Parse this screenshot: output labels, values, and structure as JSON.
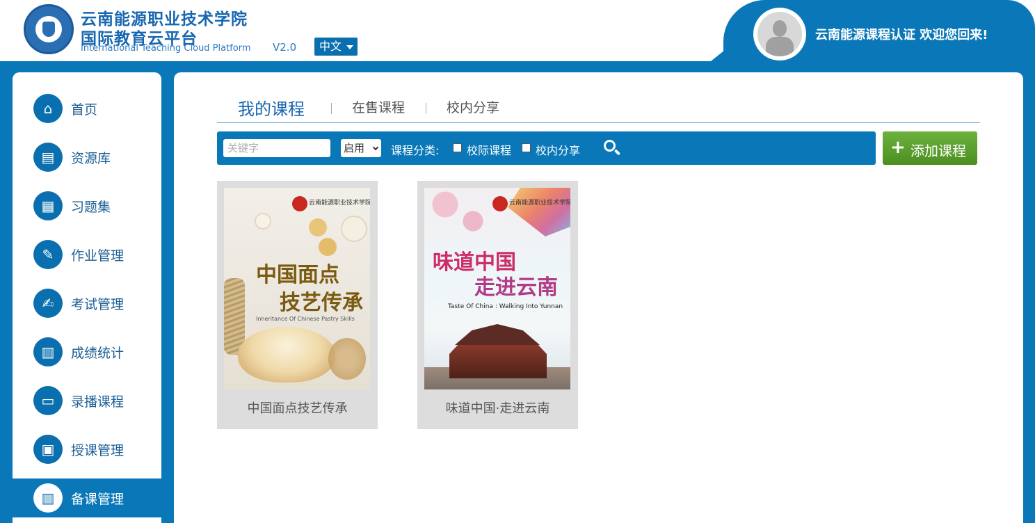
{
  "header": {
    "school_name": "云南能源职业技术学院",
    "platform_name": "国际教育云平台",
    "platform_name_en": "International Teaching Cloud Platform",
    "version": "V2.0",
    "language": "中文",
    "welcome": "云南能源课程认证 欢迎您回来!"
  },
  "sidebar": {
    "items": [
      {
        "label": "首页",
        "icon": "home-icon",
        "glyph": "⌂"
      },
      {
        "label": "资源库",
        "icon": "briefcase-icon",
        "glyph": "▤"
      },
      {
        "label": "习题集",
        "icon": "notebook-icon",
        "glyph": "▦"
      },
      {
        "label": "作业管理",
        "icon": "edit-icon",
        "glyph": "✎"
      },
      {
        "label": "考试管理",
        "icon": "exam-icon",
        "glyph": "✍"
      },
      {
        "label": "成绩统计",
        "icon": "bar-chart-icon",
        "glyph": "▥"
      },
      {
        "label": "录播课程",
        "icon": "presentation-icon",
        "glyph": "▭"
      },
      {
        "label": "授课管理",
        "icon": "id-card-icon",
        "glyph": "▣"
      },
      {
        "label": "备课管理",
        "icon": "books-icon",
        "glyph": "▥"
      }
    ],
    "active_index": 8
  },
  "tabs": [
    {
      "label": "我的课程",
      "active": true
    },
    {
      "label": "在售课程",
      "active": false
    },
    {
      "label": "校内分享",
      "active": false
    }
  ],
  "filter": {
    "keyword_placeholder": "关键字",
    "keyword_value": "",
    "status_selected": "启用",
    "category_label": "课程分类:",
    "checkboxes": [
      {
        "label": "校际课程",
        "checked": false
      },
      {
        "label": "校内分享",
        "checked": false
      }
    ],
    "add_button": "添加课程"
  },
  "courses": [
    {
      "title": "中国面点技艺传承",
      "cover_school": "云南能源职业技术学院",
      "cover_title_1": "中国面点",
      "cover_title_2": "技艺传承",
      "cover_en": "Inheritance Of Chinese Pastry Skills"
    },
    {
      "title": "味道中国·走进云南",
      "cover_school": "云南能源职业技术学院",
      "cover_title_1": "味道中国",
      "cover_title_2": "走进云南",
      "cover_en": "Taste Of China : Walking Into Yunnan"
    }
  ],
  "colors": {
    "primary": "#0a78b8",
    "accent_green": "#5aa02c",
    "text_blue": "#1766b0"
  }
}
